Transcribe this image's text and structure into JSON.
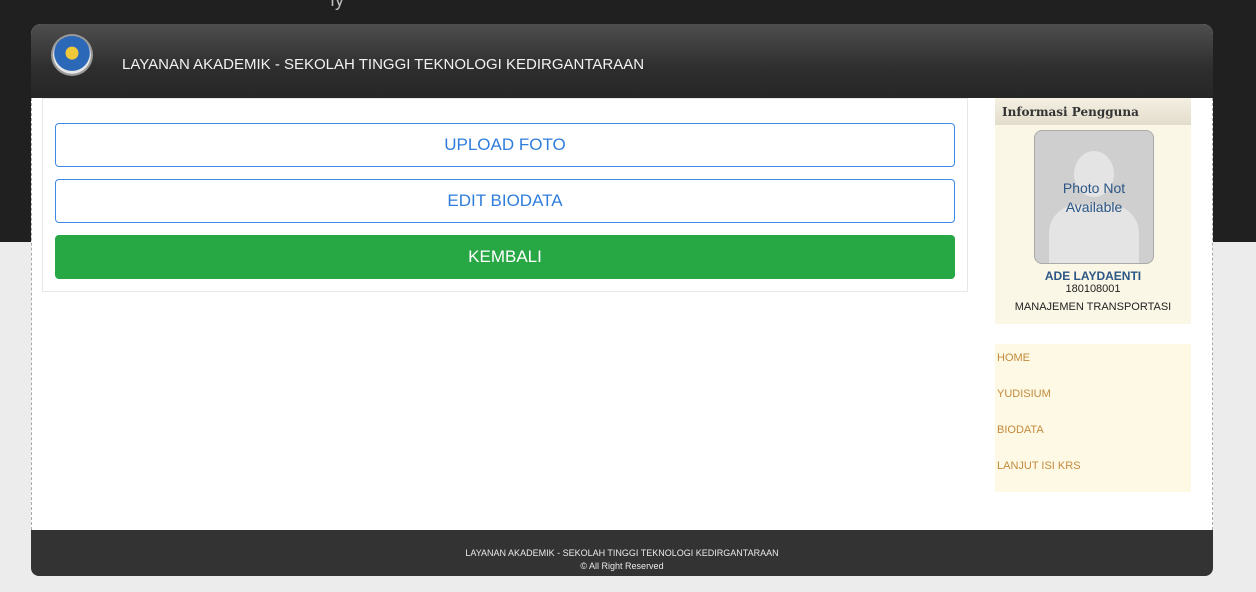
{
  "header": {
    "title": "LAYANAN AKADEMIK - SEKOLAH TINGGI TEKNOLOGI KEDIRGANTARAAN"
  },
  "top_strip": {
    "text": "ıy"
  },
  "actions": {
    "upload_label": "UPLOAD FOTO",
    "edit_label": "EDIT BIODATA",
    "back_label": "KEMBALI"
  },
  "user_panel": {
    "title": "Informasi Pengguna",
    "photo_text_line1": "Photo Not",
    "photo_text_line2": "Available",
    "name": "ADE LAYDAENTI",
    "nim": "180108001",
    "prodi": "MANAJEMEN TRANSPORTASI"
  },
  "menu": {
    "items": [
      {
        "label": "HOME"
      },
      {
        "label": "YUDISIUM"
      },
      {
        "label": "BIODATA"
      },
      {
        "label": "LANJUT ISI KRS"
      }
    ]
  },
  "footer": {
    "line1": "LAYANAN AKADEMIK - SEKOLAH TINGGI TEKNOLOGI KEDIRGANTARAAN",
    "line2": "© All Right Reserved"
  },
  "colors": {
    "outline_button": "#2f7ddc",
    "back_button": "#28a745",
    "menu_link": "#c48a3e",
    "header_bg": "#333333"
  }
}
